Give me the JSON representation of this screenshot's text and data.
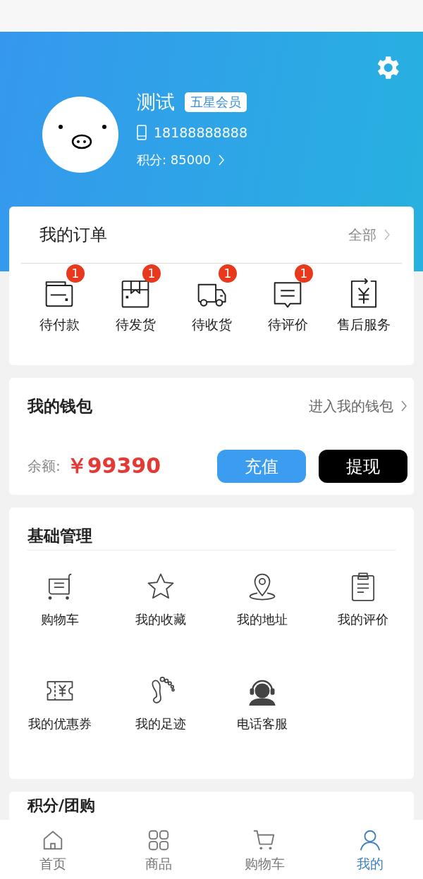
{
  "profile": {
    "name": "测试",
    "badge": "五星会员",
    "phone": "18188888888",
    "points": "积分: 85000"
  },
  "orders": {
    "title": "我的订单",
    "more": "全部",
    "items": [
      {
        "kind": "payment",
        "label": "待付款",
        "badge": "1"
      },
      {
        "kind": "package",
        "label": "待发货",
        "badge": "1"
      },
      {
        "kind": "truck",
        "label": "待收货",
        "badge": "1"
      },
      {
        "kind": "comment",
        "label": "待评价",
        "badge": "1"
      },
      {
        "kind": "refund",
        "label": "售后服务"
      }
    ]
  },
  "wallet": {
    "title": "我的钱包",
    "more": "进入我的钱包",
    "balance_label": "余额:",
    "balance": "￥99390",
    "buttons": [
      {
        "kind": "primary",
        "label": "充值"
      },
      {
        "kind": "dark",
        "label": "提现"
      }
    ]
  },
  "basic": {
    "title": "基础管理",
    "items": [
      {
        "kind": "cart",
        "label": "购物车"
      },
      {
        "kind": "star",
        "label": "我的收藏"
      },
      {
        "kind": "pin",
        "label": "我的地址"
      },
      {
        "kind": "clipboard",
        "label": "我的评价"
      },
      {
        "kind": "coupon",
        "label": "我的优惠券"
      },
      {
        "kind": "foot",
        "label": "我的足迹"
      },
      {
        "kind": "headset",
        "label": "电话客服"
      }
    ]
  },
  "points_section": {
    "title": "积分/团购"
  },
  "tabs": [
    {
      "kind": "home",
      "label": "首页",
      "selected": false
    },
    {
      "kind": "grid",
      "label": "商品",
      "selected": false
    },
    {
      "kind": "cart",
      "label": "购物车",
      "selected": false
    },
    {
      "kind": "user",
      "label": "我的",
      "selected": true
    }
  ]
}
